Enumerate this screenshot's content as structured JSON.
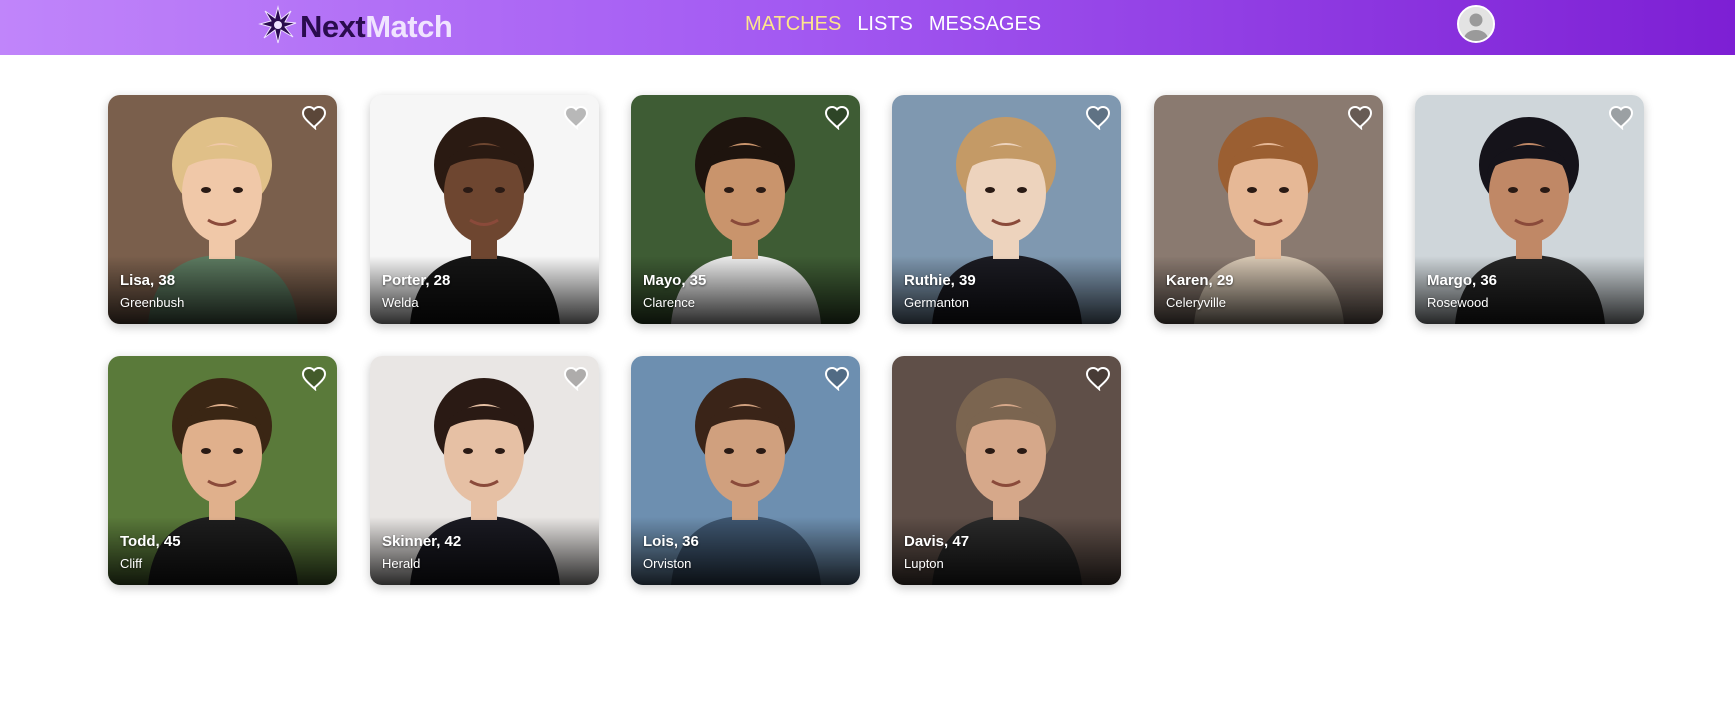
{
  "brand": {
    "part1": "Next",
    "part2": "Match",
    "logo_icon": "spark-logo-icon"
  },
  "nav": {
    "links": [
      "MATCHES",
      "LISTS",
      "MESSAGES"
    ],
    "active": "MATCHES"
  },
  "user": {
    "avatar_icon": "user-avatar-icon"
  },
  "colors": {
    "nav_start": "#c085fa",
    "nav_end": "#7d1fd4",
    "active_link": "#fde68a"
  },
  "members": [
    {
      "name": "Lisa, 38",
      "city": "Greenbush",
      "bg": "#7a5f4c",
      "skin": "#f0c8a8",
      "hair": "#e0c088",
      "shirt": "#5c7a60"
    },
    {
      "name": "Porter, 28",
      "city": "Welda",
      "bg": "#f6f6f6",
      "skin": "#6e4630",
      "hair": "#2a1a12",
      "shirt": "#151515"
    },
    {
      "name": "Mayo, 35",
      "city": "Clarence",
      "bg": "#3e5c34",
      "skin": "#c9946c",
      "hair": "#1e140e",
      "shirt": "#ececec"
    },
    {
      "name": "Ruthie, 39",
      "city": "Germanton",
      "bg": "#7f98b0",
      "skin": "#edd3bd",
      "hair": "#c49a66",
      "shirt": "#1b1b22"
    },
    {
      "name": "Karen, 29",
      "city": "Celeryville",
      "bg": "#8a7a70",
      "skin": "#e6b896",
      "hair": "#9b5f32",
      "shirt": "#d8c8b4"
    },
    {
      "name": "Margo, 36",
      "city": "Rosewood",
      "bg": "#cfd6da",
      "skin": "#c08866",
      "hair": "#15131a",
      "shirt": "#262626"
    },
    {
      "name": "Todd, 45",
      "city": "Cliff",
      "bg": "#5a7a3a",
      "skin": "#e0b08c",
      "hair": "#3a2614",
      "shirt": "#1e1e1e"
    },
    {
      "name": "Skinner, 42",
      "city": "Herald",
      "bg": "#e9e6e4",
      "skin": "#e6c0a4",
      "hair": "#2a1a14",
      "shirt": "#1a1a22"
    },
    {
      "name": "Lois, 36",
      "city": "Orviston",
      "bg": "#6d8fb0",
      "skin": "#d0a07e",
      "hair": "#3a2418",
      "shirt": "#3e5670"
    },
    {
      "name": "Davis, 47",
      "city": "Lupton",
      "bg": "#5f4f48",
      "skin": "#d6a88a",
      "hair": "#7b6550",
      "shirt": "#2a2a2a"
    }
  ]
}
